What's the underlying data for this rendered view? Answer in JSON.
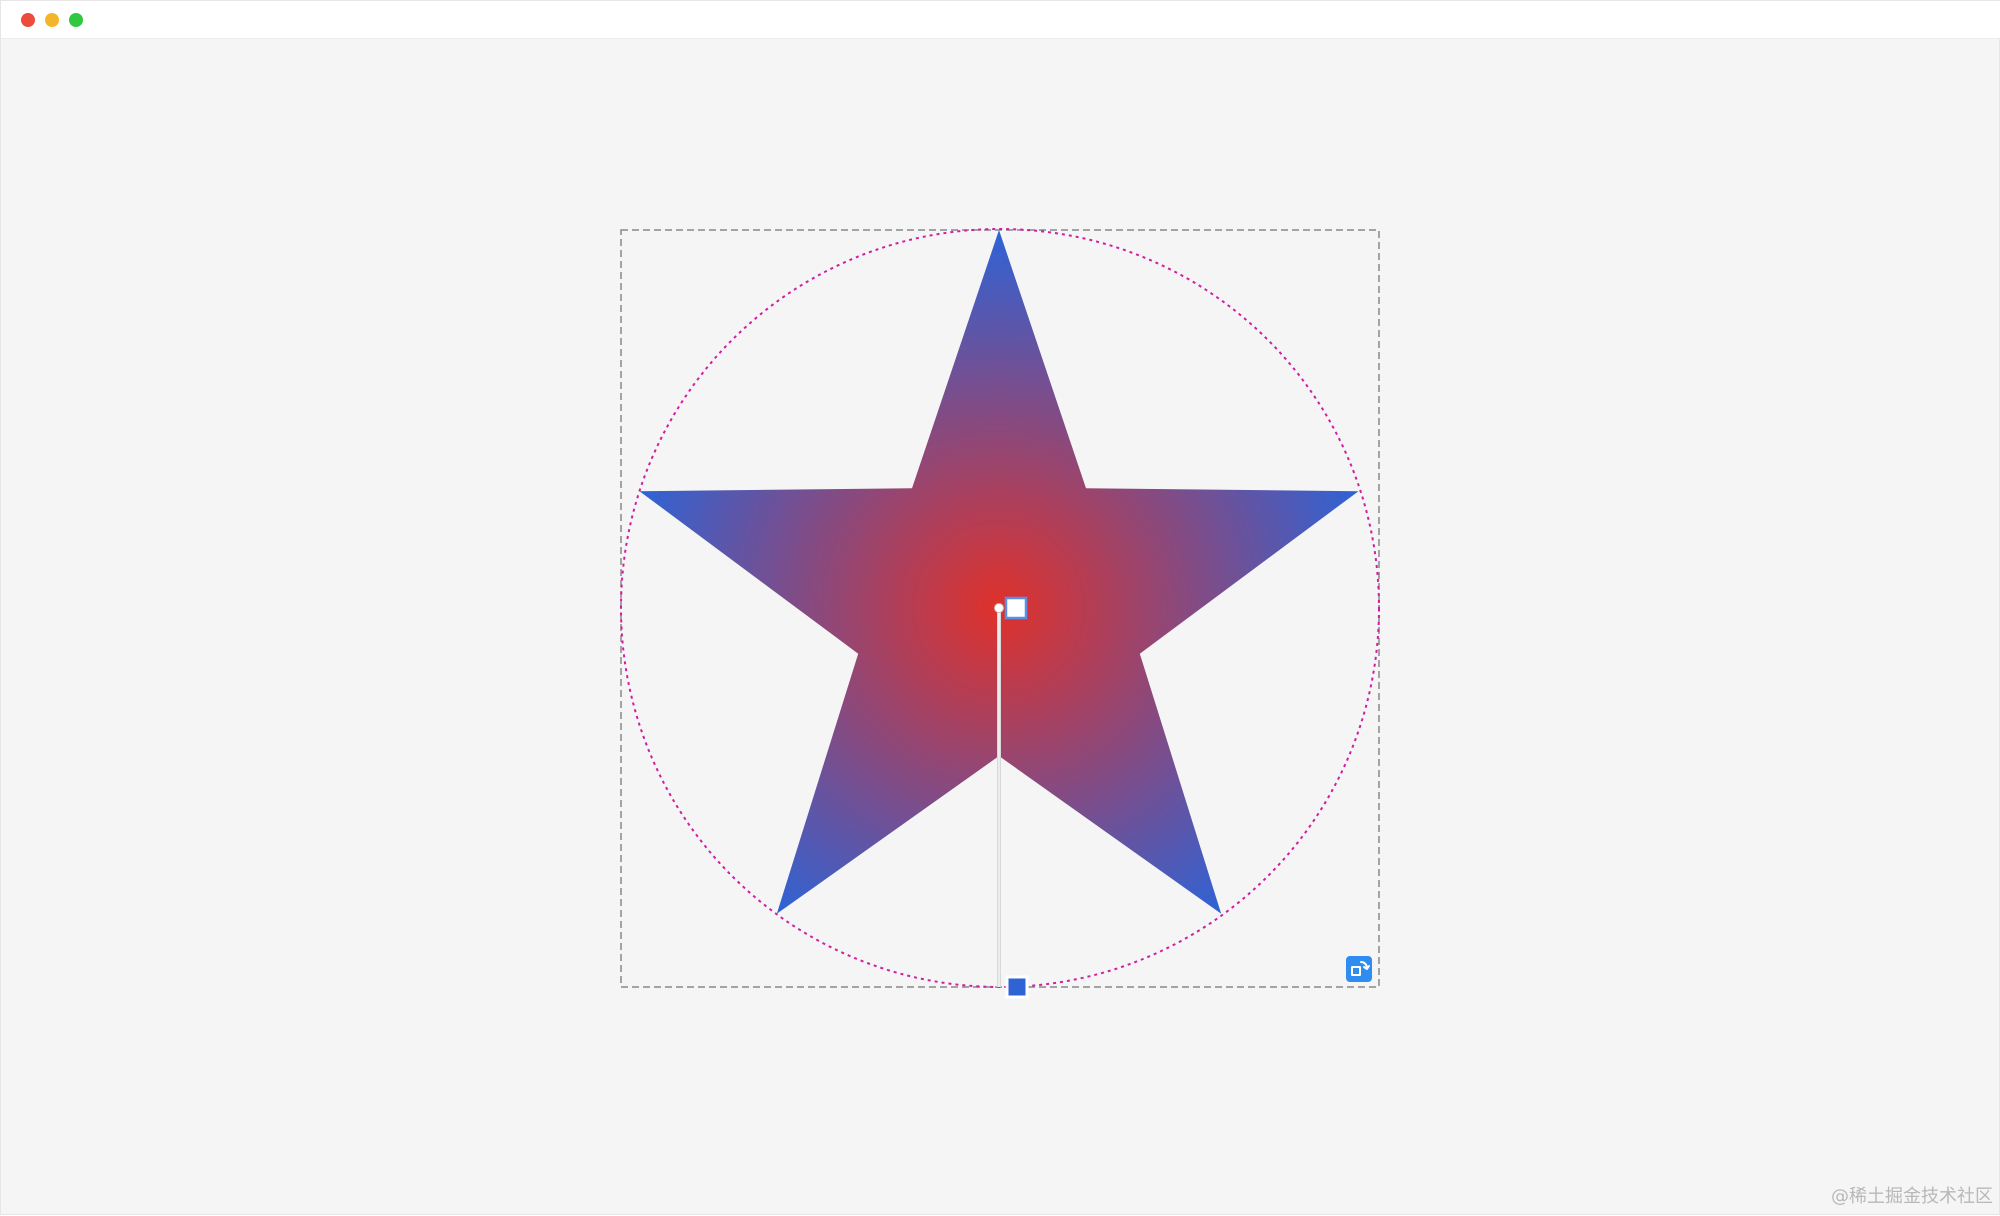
{
  "window": {
    "controls": [
      {
        "name": "close",
        "color": "#ed4c3c"
      },
      {
        "name": "minimize",
        "color": "#f5b52b"
      },
      {
        "name": "maximize",
        "color": "#2fc840"
      }
    ]
  },
  "shape": {
    "type": "star",
    "gradient": {
      "kind": "radial",
      "stops": [
        {
          "offset": "0%",
          "color": "#e0312a"
        },
        {
          "offset": "100%",
          "color": "#2e63d6"
        }
      ]
    },
    "circle_guide_color": "#cf1fa0",
    "bbox_stroke_color": "#8a8a8a"
  },
  "gradient_controls": {
    "center_handle_fill": "#ffffff",
    "center_handle_border": "#5b8fe6",
    "end_handle_fill": "#2e63d6",
    "end_handle_border": "#ffffff",
    "line_color": "#d8d8d8"
  },
  "rotate_button": {
    "icon": "rotate-icon",
    "color": "#2f8cf0"
  },
  "watermark": "@稀土掘金技术社区"
}
